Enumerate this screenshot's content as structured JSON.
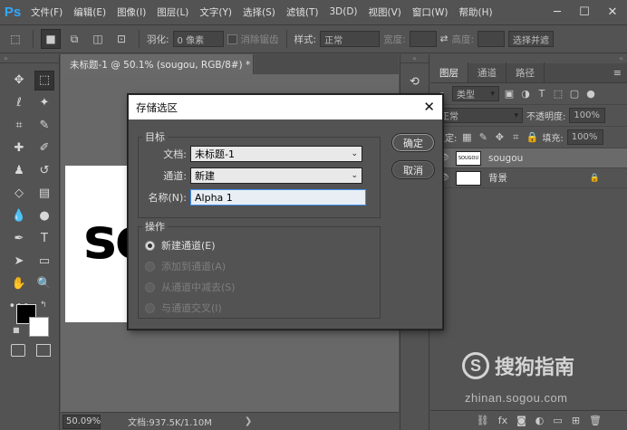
{
  "app": {
    "logo": "Ps",
    "menu": [
      "文件(F)",
      "编辑(E)",
      "图像(I)",
      "图层(L)",
      "文字(Y)",
      "选择(S)",
      "滤镜(T)",
      "3D(D)",
      "视图(V)",
      "窗口(W)",
      "帮助(H)"
    ],
    "window_controls": {
      "minimize": "─",
      "maximize": "☐",
      "close": "✕"
    }
  },
  "options_bar": {
    "feather_label": "羽化:",
    "feather_value": "0 像素",
    "antialias_label": "消除锯齿",
    "style_label": "样式:",
    "style_value": "正常",
    "width_label": "宽度:",
    "height_label": "高度:",
    "select_mask_label": "选择并遮"
  },
  "document": {
    "tab_title": "未标题-1 @ 50.1% (sougou, RGB/8#) *",
    "tab_close": "×",
    "canvas_text": "so",
    "zoom": "50.09%",
    "doc_info": "文档:937.5K/1.10M",
    "status_arrow": "❯"
  },
  "layers_panel": {
    "tabs": [
      "图层",
      "通道",
      "路径"
    ],
    "filter_kind": "类型",
    "blend_mode": "正常",
    "opacity_label": "不透明度:",
    "opacity_value": "100%",
    "lock_label": "锁定:",
    "fill_label": "填充:",
    "fill_value": "100%",
    "layers": [
      {
        "name": "sougou",
        "thumb_text": "SOUGOU",
        "selected": true
      },
      {
        "name": "背景",
        "selected": false
      }
    ]
  },
  "dialog": {
    "title": "存储选区",
    "close": "✕",
    "destination": {
      "legend": "目标",
      "document_label": "文档:",
      "document_value": "未标题-1",
      "channel_label": "通道:",
      "channel_value": "新建",
      "name_label": "名称(N):",
      "name_value": "Alpha 1"
    },
    "operation": {
      "legend": "操作",
      "options": [
        {
          "label": "新建通道(E)",
          "checked": true,
          "enabled": true
        },
        {
          "label": "添加到通道(A)",
          "checked": false,
          "enabled": false
        },
        {
          "label": "从通道中减去(S)",
          "checked": false,
          "enabled": false
        },
        {
          "label": "与通道交叉(I)",
          "checked": false,
          "enabled": false
        }
      ]
    },
    "ok_label": "确定",
    "cancel_label": "取消"
  },
  "watermark": {
    "logo": "S",
    "text": "搜狗指南",
    "url": "zhinan.sogou.com"
  }
}
